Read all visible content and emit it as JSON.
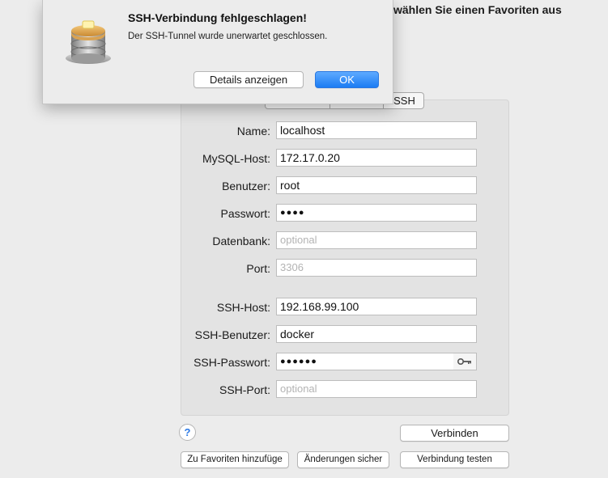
{
  "header": {
    "text": "wählen Sie einen Favoriten aus"
  },
  "tabs": [
    {
      "label": ""
    },
    {
      "label": ""
    },
    {
      "label": "SSH"
    }
  ],
  "form": {
    "name": {
      "label": "Name:",
      "value": "localhost"
    },
    "mysql_host": {
      "label": "MySQL-Host:",
      "value": "172.17.0.20"
    },
    "user": {
      "label": "Benutzer:",
      "value": "root"
    },
    "password": {
      "label": "Passwort:",
      "value": "●●●●"
    },
    "database": {
      "label": "Datenbank:",
      "placeholder": "optional"
    },
    "port": {
      "label": "Port:",
      "placeholder": "3306"
    },
    "ssh_host": {
      "label": "SSH-Host:",
      "value": "192.168.99.100"
    },
    "ssh_user": {
      "label": "SSH-Benutzer:",
      "value": "docker"
    },
    "ssh_password": {
      "label": "SSH-Passwort:",
      "value": "●●●●●●"
    },
    "ssh_port": {
      "label": "SSH-Port:",
      "placeholder": "optional"
    }
  },
  "buttons": {
    "help": "?",
    "connect": "Verbinden",
    "add_favorite": "Zu Favoriten hinzufüge",
    "save_changes": "Änderungen sicher",
    "test_connection": "Verbindung testen"
  },
  "alert": {
    "title": "SSH-Verbindung fehlgeschlagen!",
    "message": "Der SSH-Tunnel wurde unerwartet geschlossen.",
    "details_button": "Details anzeigen",
    "ok_button": "OK",
    "icon": "sequel-pro-pancake-icon"
  },
  "colors": {
    "accent": "#1c7cf3"
  }
}
